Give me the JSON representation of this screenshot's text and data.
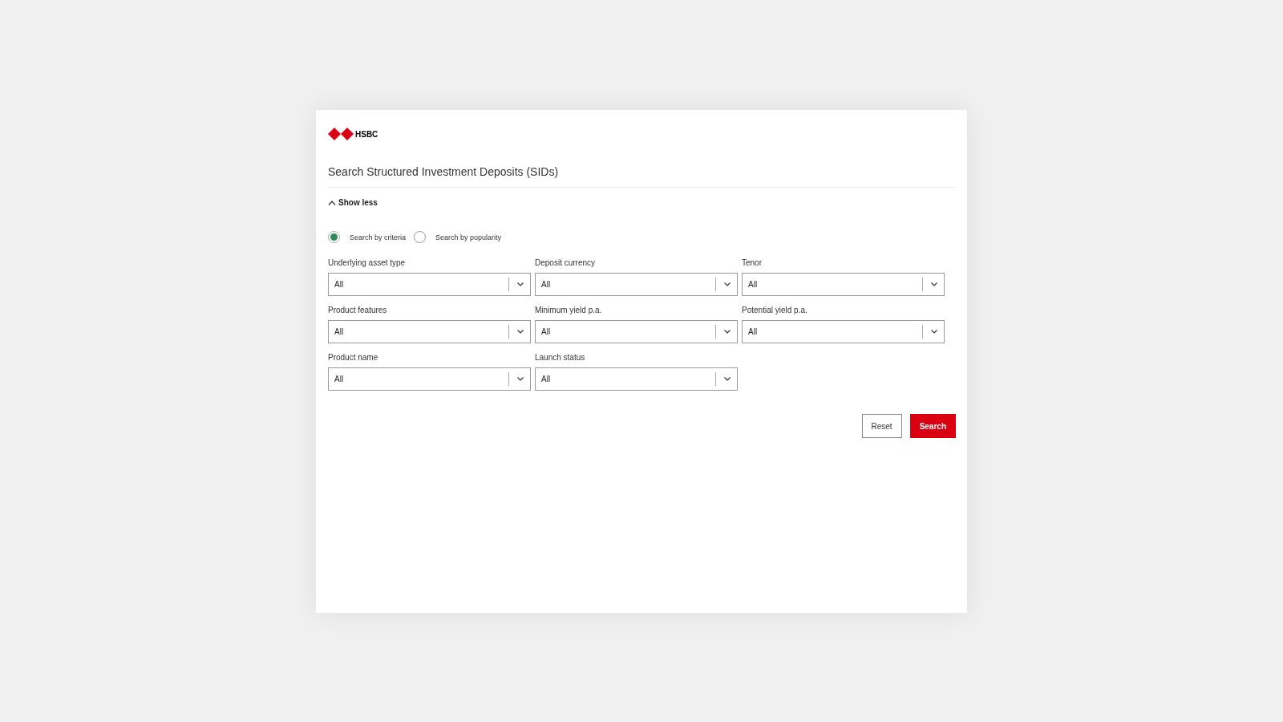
{
  "logo": {
    "text": "HSBC"
  },
  "title": "Search Structured Investment Deposits (SIDs)",
  "toggle": {
    "label": "Show less",
    "expanded": true
  },
  "search_modes": [
    {
      "label": "Search by criteria",
      "selected": true
    },
    {
      "label": "Search by popularity",
      "selected": false
    }
  ],
  "filters": [
    {
      "label": "Underlying asset type",
      "value": "All"
    },
    {
      "label": "Deposit currency",
      "value": "All"
    },
    {
      "label": "Tenor",
      "value": "All"
    },
    {
      "label": "Product features",
      "value": "All"
    },
    {
      "label": "Minimum yield p.a.",
      "value": "All"
    },
    {
      "label": "Potential yield p.a.",
      "value": "All"
    },
    {
      "label": "Product name",
      "value": "All"
    },
    {
      "label": "Launch status",
      "value": "All"
    }
  ],
  "buttons": [
    {
      "label": "Reset",
      "kind": "secondary"
    },
    {
      "label": "Search",
      "kind": "primary"
    }
  ]
}
